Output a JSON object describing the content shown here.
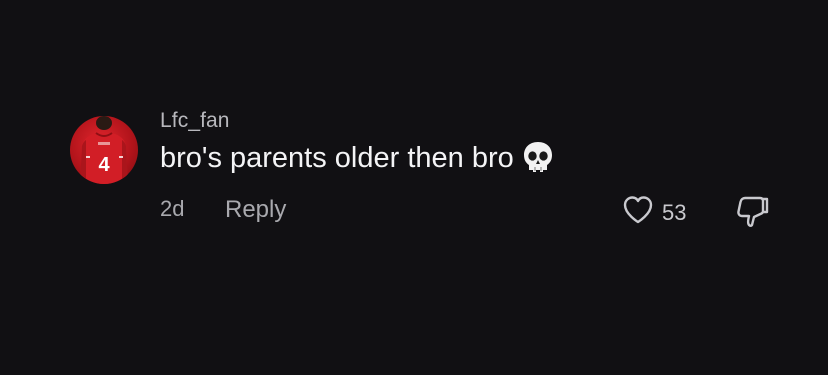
{
  "comment": {
    "username": "Lfc_fan",
    "text": "bro's parents older then bro",
    "emoji": "skull-icon",
    "age": "2d",
    "reply_label": "Reply",
    "like_count": "53",
    "icons": {
      "like": "heart-icon",
      "dislike": "thumbs-down-icon"
    }
  },
  "avatar": {
    "shirt_number": "4"
  },
  "colors": {
    "background": "#111013",
    "username": "#b8b8bd",
    "text": "#f4f4f6",
    "meta": "#a9a9ae",
    "avatar_red": "#c41a21"
  }
}
